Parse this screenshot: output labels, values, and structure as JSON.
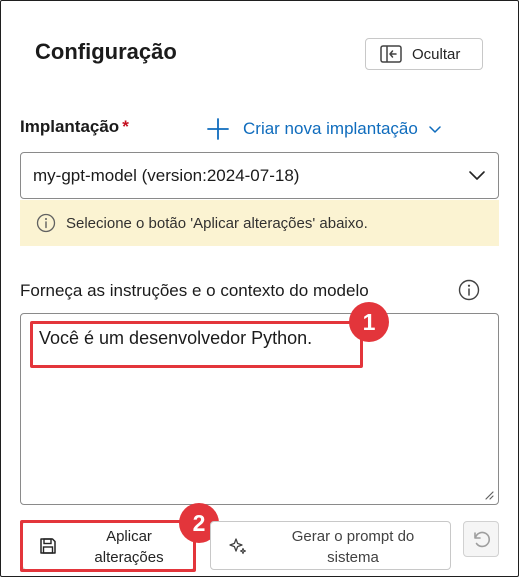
{
  "panel": {
    "title": "Configuração",
    "hide_button": "Ocultar"
  },
  "deployment": {
    "label": "Implantação",
    "required_mark": "*",
    "create_link": "Criar nova implantação",
    "selected_value": "my-gpt-model (version:2024-07-18)"
  },
  "notice": {
    "message": "Selecione o botão 'Aplicar alterações' abaixo."
  },
  "instructions": {
    "label": "Forneça as instruções e o contexto do modelo",
    "value": "Você é um desenvolvedor Python."
  },
  "actions": {
    "apply_line1": "Aplicar",
    "apply_line2": "alterações",
    "generate_line1": "Gerar o prompt do",
    "generate_line2": "sistema"
  },
  "annotations": {
    "step1": "1",
    "step2": "2"
  },
  "colors": {
    "accent": "#0f6cbd",
    "highlight": "#e3353b",
    "notice_bg": "#fbf3d2",
    "required": "#c50f1f"
  }
}
